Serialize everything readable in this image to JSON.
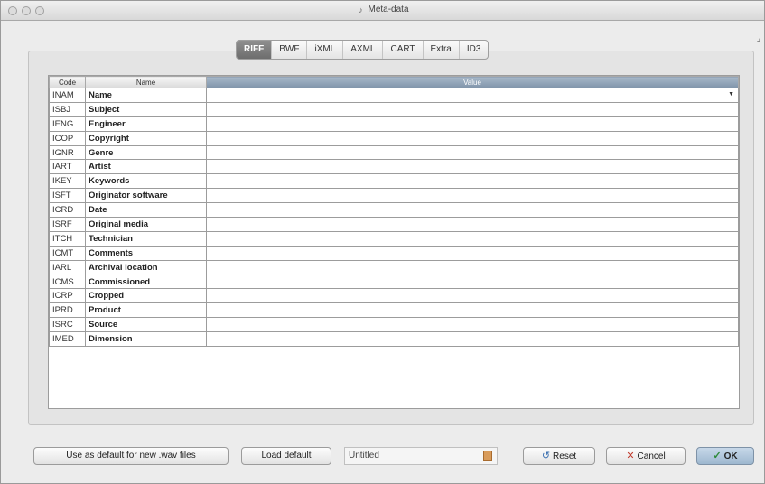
{
  "window": {
    "title": "Meta-data"
  },
  "tabs": [
    {
      "label": "RIFF",
      "active": true
    },
    {
      "label": "BWF",
      "active": false
    },
    {
      "label": "iXML",
      "active": false
    },
    {
      "label": "AXML",
      "active": false
    },
    {
      "label": "CART",
      "active": false
    },
    {
      "label": "Extra",
      "active": false
    },
    {
      "label": "ID3",
      "active": false
    }
  ],
  "table": {
    "headers": {
      "code": "Code",
      "name": "Name",
      "value": "Value"
    },
    "rows": [
      {
        "code": "INAM",
        "name": "Name",
        "value": ""
      },
      {
        "code": "ISBJ",
        "name": "Subject",
        "value": ""
      },
      {
        "code": "IENG",
        "name": "Engineer",
        "value": ""
      },
      {
        "code": "ICOP",
        "name": "Copyright",
        "value": ""
      },
      {
        "code": "IGNR",
        "name": "Genre",
        "value": ""
      },
      {
        "code": "IART",
        "name": "Artist",
        "value": ""
      },
      {
        "code": "IKEY",
        "name": "Keywords",
        "value": ""
      },
      {
        "code": "ISFT",
        "name": "Originator software",
        "value": ""
      },
      {
        "code": "ICRD",
        "name": "Date",
        "value": ""
      },
      {
        "code": "ISRF",
        "name": "Original media",
        "value": ""
      },
      {
        "code": "ITCH",
        "name": "Technician",
        "value": ""
      },
      {
        "code": "ICMT",
        "name": "Comments",
        "value": ""
      },
      {
        "code": "IARL",
        "name": "Archival location",
        "value": ""
      },
      {
        "code": "ICMS",
        "name": "Commissioned",
        "value": ""
      },
      {
        "code": "ICRP",
        "name": "Cropped",
        "value": ""
      },
      {
        "code": "IPRD",
        "name": "Product",
        "value": ""
      },
      {
        "code": "ISRC",
        "name": "Source",
        "value": ""
      },
      {
        "code": "IMED",
        "name": "Dimension",
        "value": ""
      }
    ]
  },
  "bottom": {
    "use_default_label": "Use as default for new .wav files",
    "load_default_label": "Load default",
    "preset_value": "Untitled",
    "reset_label": "Reset",
    "cancel_label": "Cancel",
    "ok_label": "OK"
  },
  "colors": {
    "active_tab": "#7a7a7a",
    "value_header": "#8fa3b8",
    "ok_button": "#a9c0d6"
  }
}
